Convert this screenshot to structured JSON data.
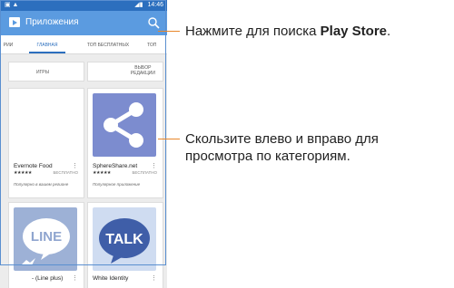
{
  "status_bar": {
    "time": "14:46"
  },
  "app_bar": {
    "title": "Приложения"
  },
  "tabs": [
    {
      "label": "РИИ"
    },
    {
      "label": "ГЛАВНАЯ"
    },
    {
      "label": "ТОП БЕСПЛАТНЫХ"
    },
    {
      "label": "ТОП"
    }
  ],
  "categories": {
    "games": "ИГРЫ",
    "editors_line1": "ВЫБОР",
    "editors_line2": "РЕДАКЦИИ"
  },
  "cards": [
    {
      "name": "Evernote Food",
      "stars": "★★★★★",
      "price": "БЕСПЛАТНО",
      "hint": "Популярно в вашем регионе",
      "menu": "⋮"
    },
    {
      "name": "SphereShare.net",
      "stars": "★★★★★",
      "price": "БЕСПЛАТНО",
      "hint": "Популярное приложение",
      "menu": "⋮"
    },
    {
      "name": "- (Line plus)",
      "icon_text": "LINE",
      "menu": "⋮"
    },
    {
      "name": "White Identity",
      "icon_text": "TALK",
      "menu": "⋮"
    }
  ],
  "callouts": {
    "search_pre": "Нажмите для поиска ",
    "search_bold": "Play Store",
    "search_post": ".",
    "swipe_line1": "Скользите влево и вправо для",
    "swipe_line2": "просмотра по категориям."
  },
  "colors": {
    "accent": "#2c6fbe",
    "toolbar": "#5b9be0",
    "callout_line": "#e8872a"
  }
}
